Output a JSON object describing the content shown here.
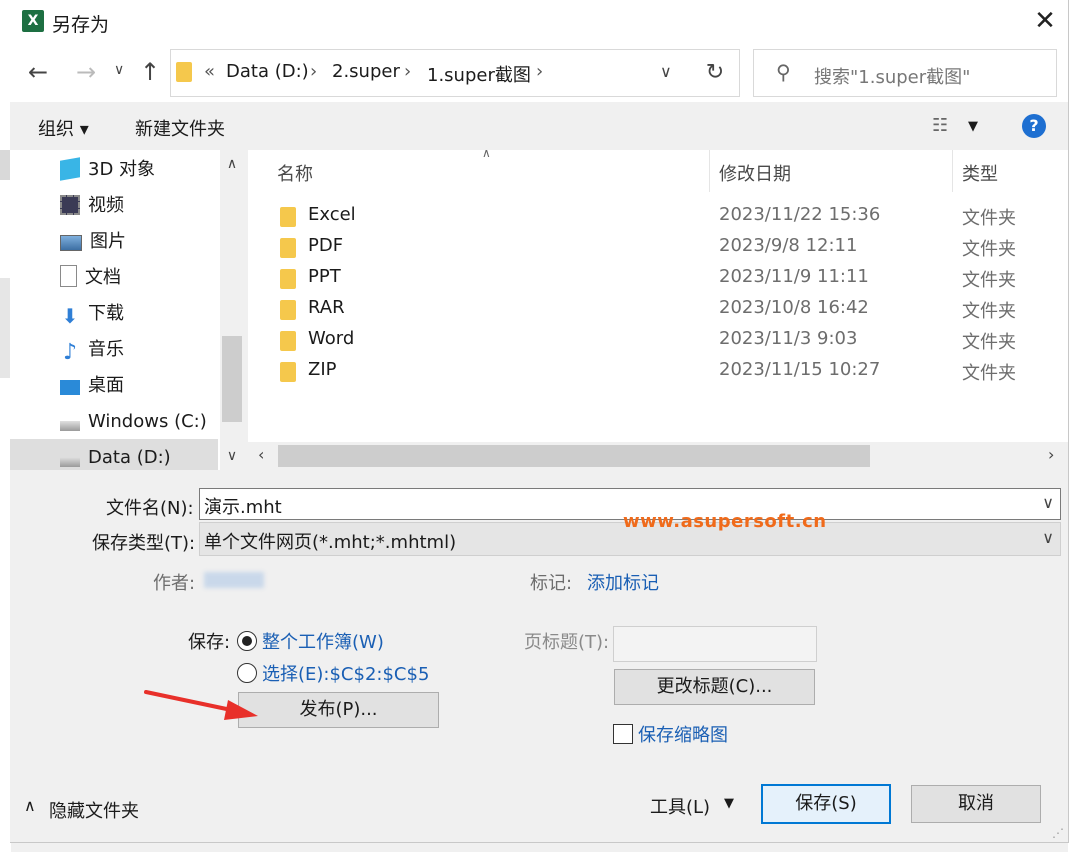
{
  "window": {
    "title": "另存为",
    "app_icon": "excel-icon",
    "close_label": "✕"
  },
  "address": {
    "crumbs": [
      "«",
      "Data (D:)",
      "2.super",
      "1.super截图"
    ],
    "search_placeholder": "搜索\"1.super截图\""
  },
  "toolbar": {
    "organize_label": "组织 ▾",
    "new_folder_label": "新建文件夹"
  },
  "nav": {
    "items": [
      {
        "label": "3D 对象",
        "icon": "3d-objects-icon"
      },
      {
        "label": "视频",
        "icon": "video-icon"
      },
      {
        "label": "图片",
        "icon": "pictures-icon"
      },
      {
        "label": "文档",
        "icon": "documents-icon"
      },
      {
        "label": "下载",
        "icon": "downloads-icon"
      },
      {
        "label": "音乐",
        "icon": "music-icon"
      },
      {
        "label": "桌面",
        "icon": "desktop-icon"
      },
      {
        "label": "Windows (C:)",
        "icon": "drive-icon"
      },
      {
        "label": "Data (D:)",
        "icon": "drive-icon",
        "selected": true
      }
    ]
  },
  "files": {
    "columns": [
      "名称",
      "修改日期",
      "类型"
    ],
    "rows": [
      {
        "name": "Excel",
        "date": "2023/11/22 15:36",
        "type": "文件夹"
      },
      {
        "name": "PDF",
        "date": "2023/9/8 12:11",
        "type": "文件夹"
      },
      {
        "name": "PPT",
        "date": "2023/11/9 11:11",
        "type": "文件夹"
      },
      {
        "name": "RAR",
        "date": "2023/10/8 16:42",
        "type": "文件夹"
      },
      {
        "name": "Word",
        "date": "2023/11/3 9:03",
        "type": "文件夹"
      },
      {
        "name": "ZIP",
        "date": "2023/11/15 10:27",
        "type": "文件夹"
      }
    ]
  },
  "form": {
    "filename_label": "文件名(N):",
    "filename_value": "演示.mht",
    "filetype_label": "保存类型(T):",
    "filetype_value": "单个文件网页(*.mht;*.mhtml)",
    "author_label": "作者:",
    "tags_label": "标记:",
    "tags_link": "添加标记",
    "save_label": "保存:",
    "radio_whole": "整个工作簿(W)",
    "radio_selection": "选择(E):$C$2:$C$5",
    "publish_button": "发布(P)...",
    "page_title_label": "页标题(T):",
    "page_title_value": "",
    "change_title_button": "更改标题(C)...",
    "thumbnail_label": "保存缩略图",
    "watermark": "www.asupersoft.cn"
  },
  "footer": {
    "hide_folders": "隐藏文件夹",
    "tools_label": "工具(L)",
    "save_button": "保存(S)",
    "cancel_button": "取消"
  },
  "colors": {
    "accent": "#0078d4",
    "link": "#1a5fb4",
    "watermark": "#f06a1a",
    "arrow": "#e8302a"
  }
}
